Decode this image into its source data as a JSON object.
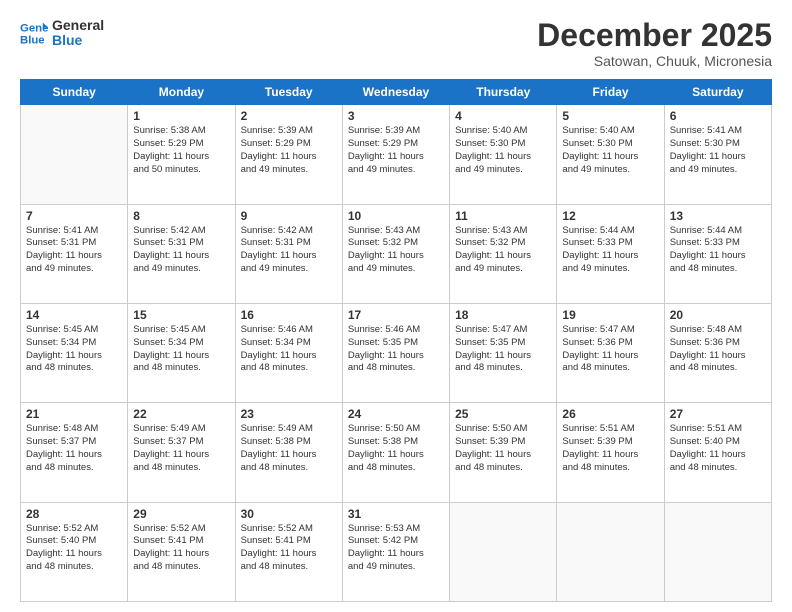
{
  "header": {
    "logo_line1": "General",
    "logo_line2": "Blue",
    "month": "December 2025",
    "location": "Satowan, Chuuk, Micronesia"
  },
  "days_of_week": [
    "Sunday",
    "Monday",
    "Tuesday",
    "Wednesday",
    "Thursday",
    "Friday",
    "Saturday"
  ],
  "weeks": [
    [
      {
        "day": "",
        "info": ""
      },
      {
        "day": "1",
        "info": "Sunrise: 5:38 AM\nSunset: 5:29 PM\nDaylight: 11 hours\nand 50 minutes."
      },
      {
        "day": "2",
        "info": "Sunrise: 5:39 AM\nSunset: 5:29 PM\nDaylight: 11 hours\nand 49 minutes."
      },
      {
        "day": "3",
        "info": "Sunrise: 5:39 AM\nSunset: 5:29 PM\nDaylight: 11 hours\nand 49 minutes."
      },
      {
        "day": "4",
        "info": "Sunrise: 5:40 AM\nSunset: 5:30 PM\nDaylight: 11 hours\nand 49 minutes."
      },
      {
        "day": "5",
        "info": "Sunrise: 5:40 AM\nSunset: 5:30 PM\nDaylight: 11 hours\nand 49 minutes."
      },
      {
        "day": "6",
        "info": "Sunrise: 5:41 AM\nSunset: 5:30 PM\nDaylight: 11 hours\nand 49 minutes."
      }
    ],
    [
      {
        "day": "7",
        "info": "Sunrise: 5:41 AM\nSunset: 5:31 PM\nDaylight: 11 hours\nand 49 minutes."
      },
      {
        "day": "8",
        "info": "Sunrise: 5:42 AM\nSunset: 5:31 PM\nDaylight: 11 hours\nand 49 minutes."
      },
      {
        "day": "9",
        "info": "Sunrise: 5:42 AM\nSunset: 5:31 PM\nDaylight: 11 hours\nand 49 minutes."
      },
      {
        "day": "10",
        "info": "Sunrise: 5:43 AM\nSunset: 5:32 PM\nDaylight: 11 hours\nand 49 minutes."
      },
      {
        "day": "11",
        "info": "Sunrise: 5:43 AM\nSunset: 5:32 PM\nDaylight: 11 hours\nand 49 minutes."
      },
      {
        "day": "12",
        "info": "Sunrise: 5:44 AM\nSunset: 5:33 PM\nDaylight: 11 hours\nand 49 minutes."
      },
      {
        "day": "13",
        "info": "Sunrise: 5:44 AM\nSunset: 5:33 PM\nDaylight: 11 hours\nand 48 minutes."
      }
    ],
    [
      {
        "day": "14",
        "info": "Sunrise: 5:45 AM\nSunset: 5:34 PM\nDaylight: 11 hours\nand 48 minutes."
      },
      {
        "day": "15",
        "info": "Sunrise: 5:45 AM\nSunset: 5:34 PM\nDaylight: 11 hours\nand 48 minutes."
      },
      {
        "day": "16",
        "info": "Sunrise: 5:46 AM\nSunset: 5:34 PM\nDaylight: 11 hours\nand 48 minutes."
      },
      {
        "day": "17",
        "info": "Sunrise: 5:46 AM\nSunset: 5:35 PM\nDaylight: 11 hours\nand 48 minutes."
      },
      {
        "day": "18",
        "info": "Sunrise: 5:47 AM\nSunset: 5:35 PM\nDaylight: 11 hours\nand 48 minutes."
      },
      {
        "day": "19",
        "info": "Sunrise: 5:47 AM\nSunset: 5:36 PM\nDaylight: 11 hours\nand 48 minutes."
      },
      {
        "day": "20",
        "info": "Sunrise: 5:48 AM\nSunset: 5:36 PM\nDaylight: 11 hours\nand 48 minutes."
      }
    ],
    [
      {
        "day": "21",
        "info": "Sunrise: 5:48 AM\nSunset: 5:37 PM\nDaylight: 11 hours\nand 48 minutes."
      },
      {
        "day": "22",
        "info": "Sunrise: 5:49 AM\nSunset: 5:37 PM\nDaylight: 11 hours\nand 48 minutes."
      },
      {
        "day": "23",
        "info": "Sunrise: 5:49 AM\nSunset: 5:38 PM\nDaylight: 11 hours\nand 48 minutes."
      },
      {
        "day": "24",
        "info": "Sunrise: 5:50 AM\nSunset: 5:38 PM\nDaylight: 11 hours\nand 48 minutes."
      },
      {
        "day": "25",
        "info": "Sunrise: 5:50 AM\nSunset: 5:39 PM\nDaylight: 11 hours\nand 48 minutes."
      },
      {
        "day": "26",
        "info": "Sunrise: 5:51 AM\nSunset: 5:39 PM\nDaylight: 11 hours\nand 48 minutes."
      },
      {
        "day": "27",
        "info": "Sunrise: 5:51 AM\nSunset: 5:40 PM\nDaylight: 11 hours\nand 48 minutes."
      }
    ],
    [
      {
        "day": "28",
        "info": "Sunrise: 5:52 AM\nSunset: 5:40 PM\nDaylight: 11 hours\nand 48 minutes."
      },
      {
        "day": "29",
        "info": "Sunrise: 5:52 AM\nSunset: 5:41 PM\nDaylight: 11 hours\nand 48 minutes."
      },
      {
        "day": "30",
        "info": "Sunrise: 5:52 AM\nSunset: 5:41 PM\nDaylight: 11 hours\nand 48 minutes."
      },
      {
        "day": "31",
        "info": "Sunrise: 5:53 AM\nSunset: 5:42 PM\nDaylight: 11 hours\nand 49 minutes."
      },
      {
        "day": "",
        "info": ""
      },
      {
        "day": "",
        "info": ""
      },
      {
        "day": "",
        "info": ""
      }
    ]
  ]
}
